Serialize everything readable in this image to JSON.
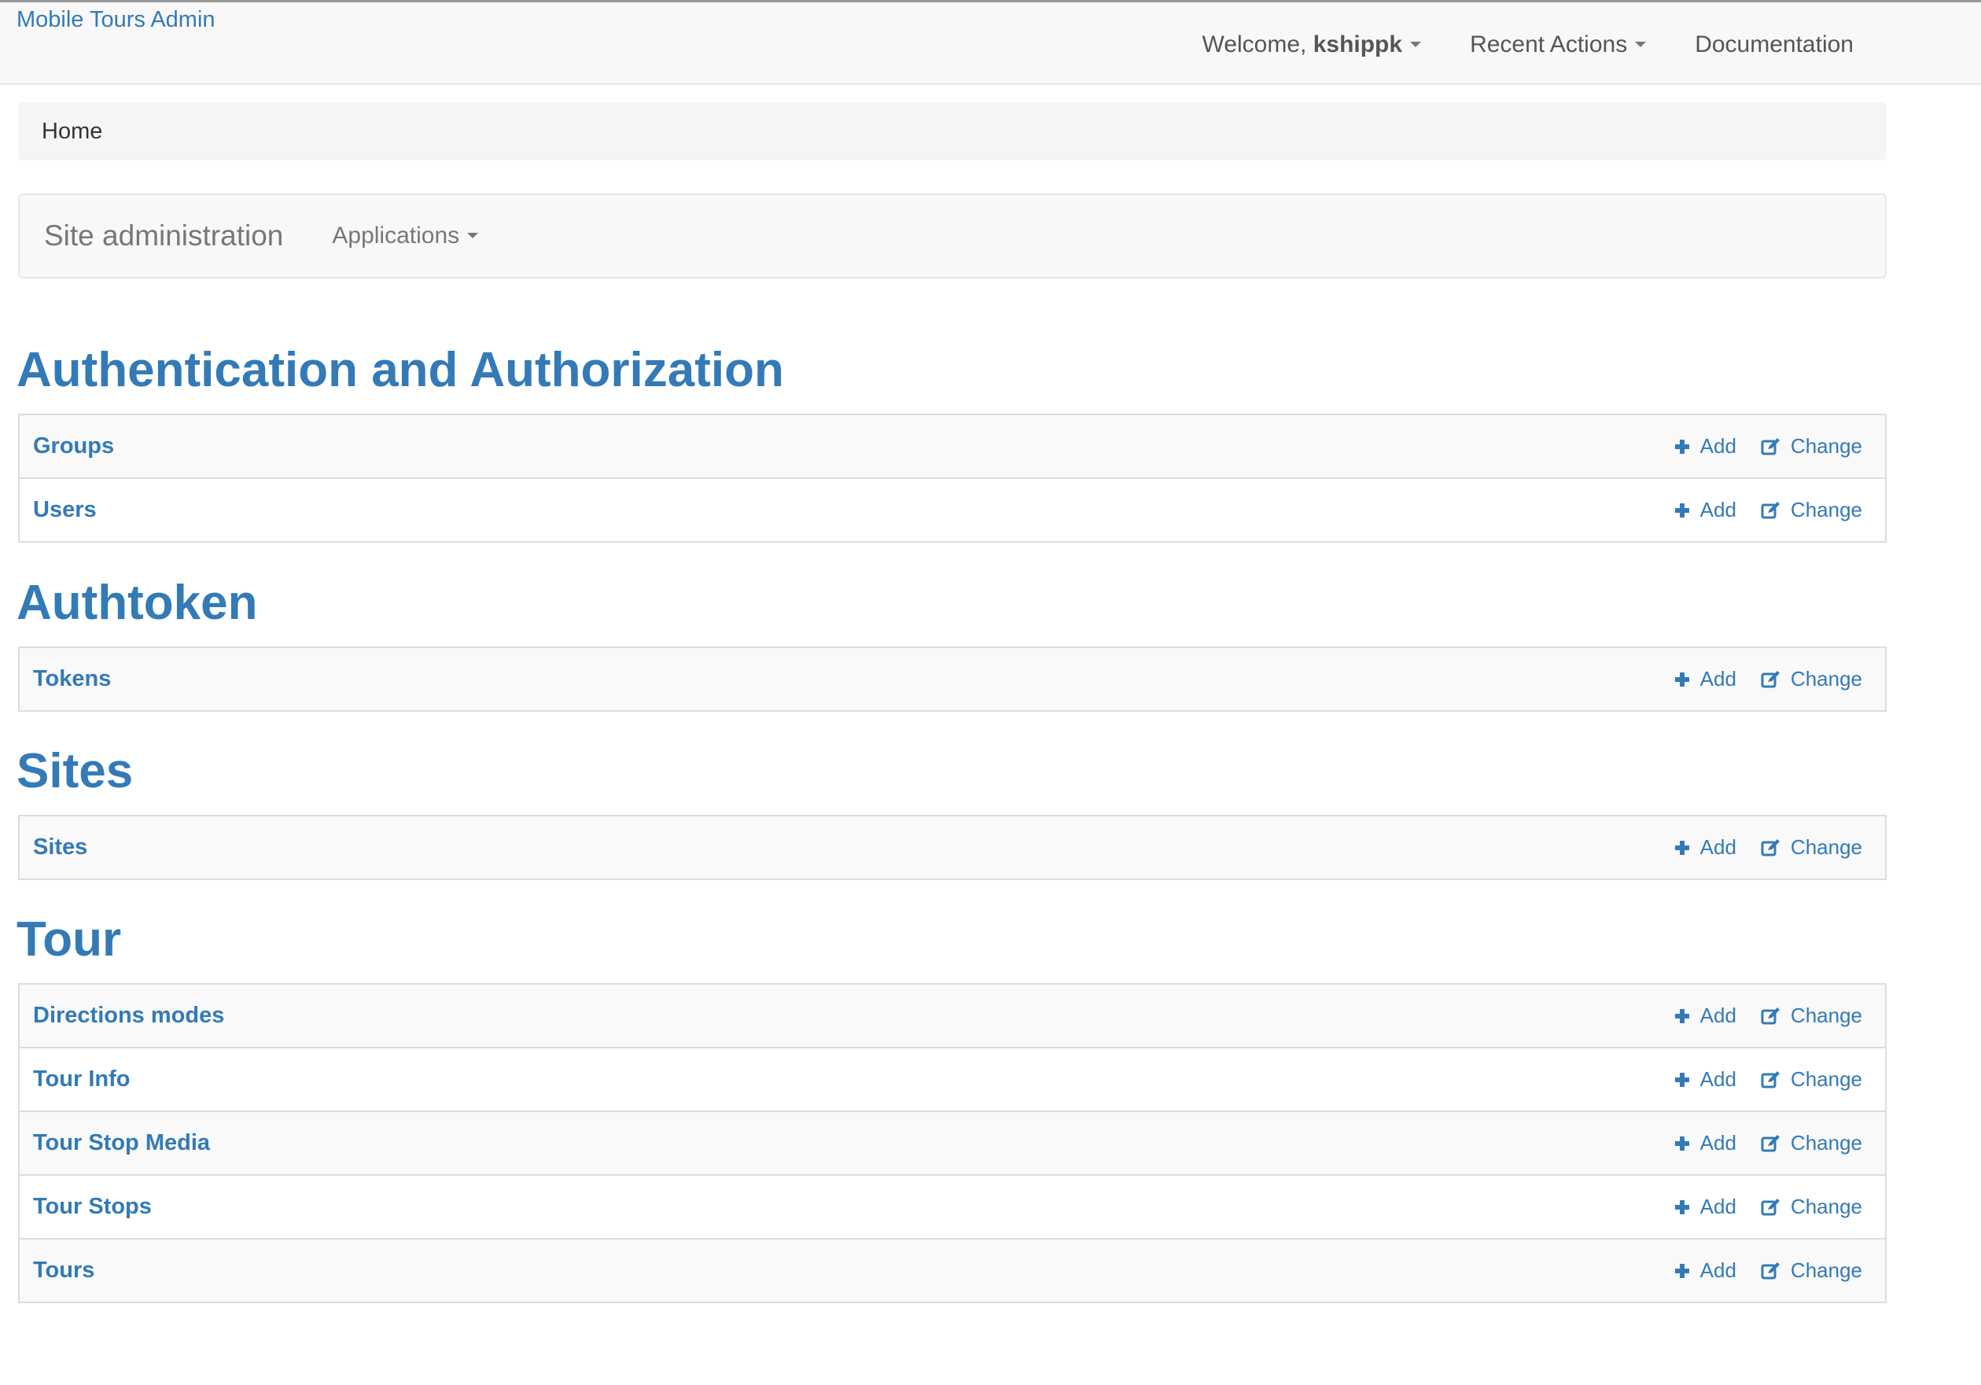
{
  "navbar": {
    "brand": "Mobile Tours Admin",
    "welcome_prefix": "Welcome, ",
    "username": "kshippk",
    "recent_actions": "Recent Actions",
    "documentation": "Documentation"
  },
  "breadcrumb": {
    "home": "Home"
  },
  "subnav": {
    "title": "Site administration",
    "applications": "Applications"
  },
  "actions": {
    "add": "Add",
    "change": "Change"
  },
  "modules": [
    {
      "title": "Authentication and Authorization",
      "models": [
        "Groups",
        "Users"
      ]
    },
    {
      "title": "Authtoken",
      "models": [
        "Tokens"
      ]
    },
    {
      "title": "Sites",
      "models": [
        "Sites"
      ]
    },
    {
      "title": "Tour",
      "models": [
        "Directions modes",
        "Tour Info",
        "Tour Stop Media",
        "Tour Stops",
        "Tours"
      ]
    }
  ],
  "colors": {
    "link": "#337ab7",
    "navbar_bg": "#f8f8f8",
    "border": "#dddddd"
  }
}
